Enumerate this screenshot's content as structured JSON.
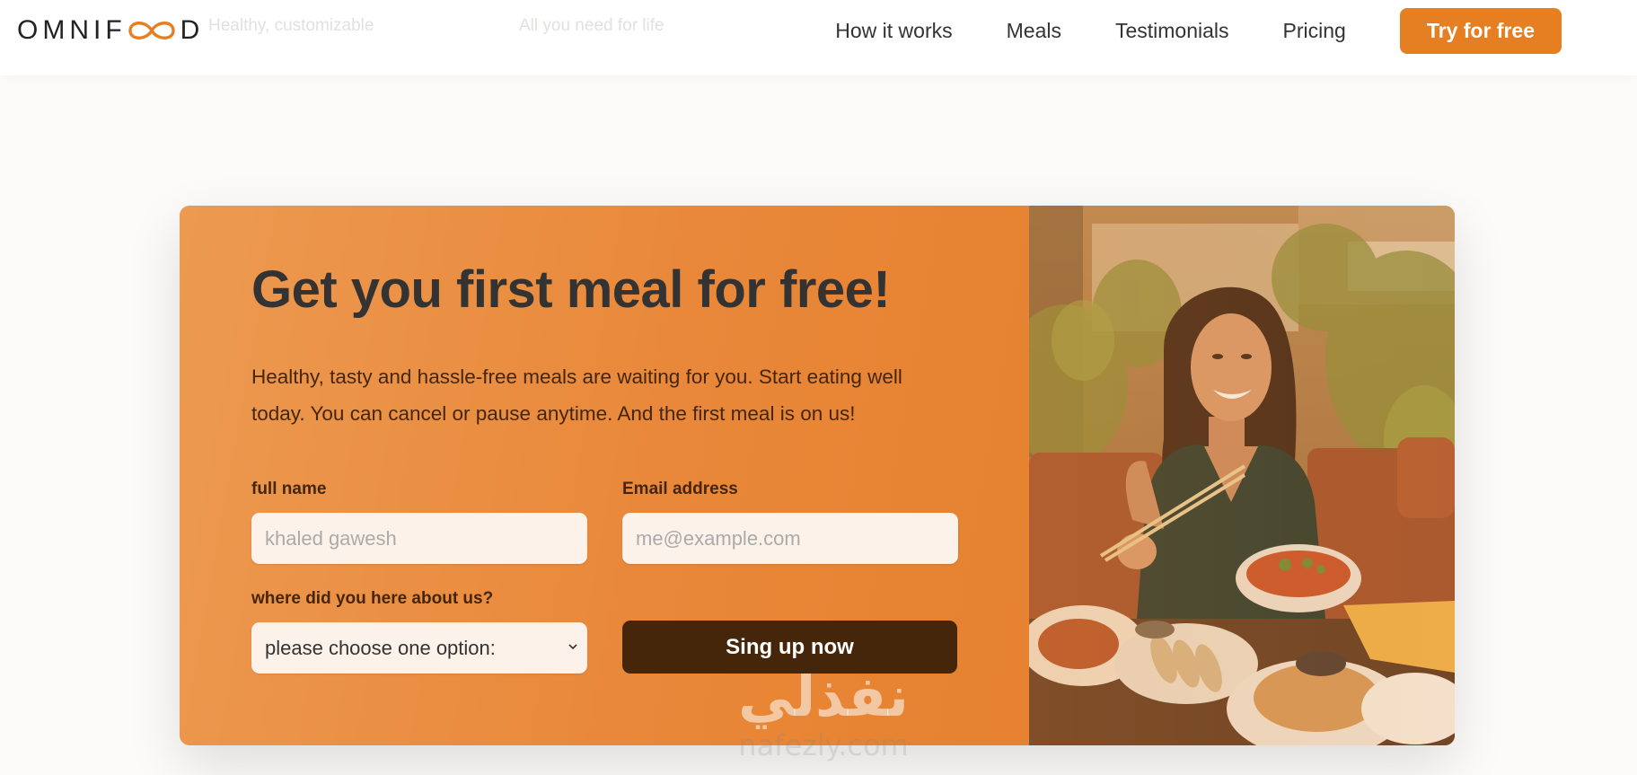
{
  "header": {
    "logo_text_left": "OMNIF",
    "logo_text_right": "D",
    "ghost_texts": [
      "Healthy, customizable",
      "All you need for life"
    ],
    "nav": [
      {
        "label": "How it works"
      },
      {
        "label": "Meals"
      },
      {
        "label": "Testimonials"
      },
      {
        "label": "Pricing"
      }
    ],
    "cta_label": "Try for free"
  },
  "cta": {
    "title": "Get you first meal for free!",
    "description": "Healthy, tasty and hassle-free meals are waiting for you. Start eating well today. You can cancel or pause anytime. And the first meal is on us!",
    "form": {
      "name_label": "full name",
      "name_placeholder": "khaled gawesh",
      "email_label": "Email address",
      "email_placeholder": "me@example.com",
      "source_label": "where did you here about us?",
      "source_selected": "please choose one option:",
      "submit_label": "Sing up now"
    }
  },
  "watermark": {
    "arabic": "نفذلي",
    "latin": "nafezly.com"
  },
  "colors": {
    "accent": "#e67e22",
    "dark_brown": "#45260a",
    "input_bg": "#fdf2e9",
    "text": "#333333"
  },
  "icons": [
    "infinity-logo-icon",
    "chevron-down-icon"
  ]
}
